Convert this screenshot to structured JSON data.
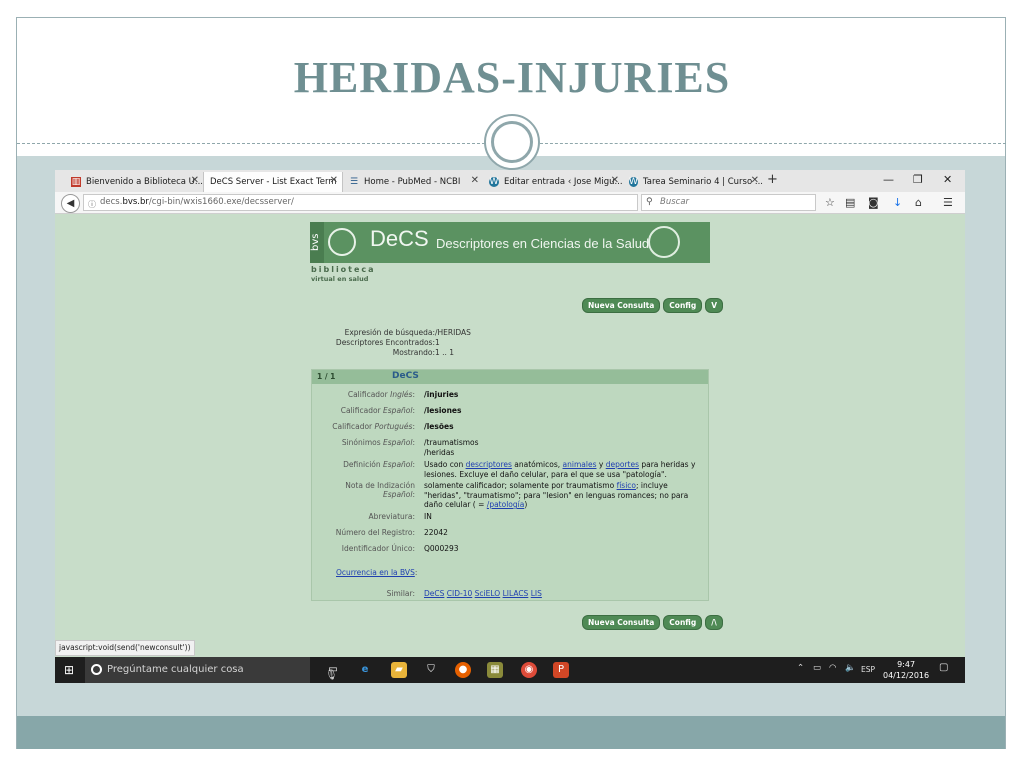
{
  "slide": {
    "title": "HERIDAS-INJURIES"
  },
  "browser": {
    "tabs": [
      {
        "label": "Bienvenido a Biblioteca U...",
        "icon": "library-favicon-icon"
      },
      {
        "label": "DeCS Server - List Exact Term",
        "icon": "none",
        "active": true
      },
      {
        "label": "Home - PubMed - NCBI",
        "icon": "pubmed-favicon-icon"
      },
      {
        "label": "Editar entrada ‹ Jose Migu...",
        "icon": "wordpress-favicon-icon"
      },
      {
        "label": "Tarea Seminario 4 | Curso ...",
        "icon": "wordpress-favicon-icon"
      }
    ],
    "url_host": "decs.bvs.br",
    "url_prefix": "decs.",
    "url_bold": "bvs.br",
    "url_path": "/cgi-bin/wxis1660.exe/decsserver/",
    "search_placeholder": "Buscar",
    "status_text": "javascript:void(send('newconsult'))"
  },
  "decs": {
    "banner_brand": "DeCS",
    "banner_subtitle": "Descriptores en Ciencias de la Salud",
    "bvs_label": "bvs",
    "biblioteca": "biblioteca",
    "virtual": "virtual en salud",
    "buttons_top": [
      "Nueva Consulta",
      "Config",
      "V"
    ],
    "buttons_bottom": [
      "Nueva Consulta",
      "Config",
      "/\\"
    ],
    "search_info": [
      {
        "label": "Expresión de búsqueda:",
        "value": "/HERIDAS"
      },
      {
        "label": "Descriptores Encontrados:",
        "value": "1"
      },
      {
        "label": "Mostrando:",
        "value": "1 .. 1"
      }
    ],
    "result": {
      "count": "1 / 1",
      "title": "DeCS",
      "calificador_ingles_label": "Calificador",
      "calificador_ingles_lang": "Inglés",
      "calificador_ingles": "/injuries",
      "calificador_espanol_label": "Calificador",
      "calificador_espanol_lang": "Español",
      "calificador_espanol": "/lesiones",
      "calificador_portugues_label": "Calificador",
      "calificador_portugues_lang": "Portugués",
      "calificador_portugues": "/lesões",
      "sinonimos_label": "Sinónimos",
      "sinonimos_lang": "Español",
      "sinonimos_1": "/traumatismos",
      "sinonimos_2": "/heridas",
      "definicion_label": "Definición",
      "definicion_lang": "Español",
      "definicion_part1": "Usado con ",
      "definicion_link1": "descriptores",
      "definicion_part2": " anatómicos, ",
      "definicion_link2": "animales",
      "definicion_part3": " y ",
      "definicion_link3": "deportes",
      "definicion_part4": " para heridas y lesiones. Excluye el daño celular, para el que se usa \"patología\".",
      "nota_label": "Nota de Indización",
      "nota_lang": "Español",
      "nota_part1": "solamente calificador; solamente por traumatismo ",
      "nota_link1": "físico",
      "nota_part2": "; incluye \"heridas\", \"traumatismo\"; para \"lesion\" en lenguas romances; no para daño celular ( = ",
      "nota_link2": "/patología",
      "nota_part3": ")",
      "abreviatura_label": "Abreviatura:",
      "abreviatura": "IN",
      "registro_label": "Número del Registro:",
      "registro": "22042",
      "identificador_label": "Identificador Único:",
      "identificador": "Q000293",
      "ocurrencia_link": "Ocurrencia en la BVS",
      "ocurrencia_suffix": ":",
      "similar_label": "Similar:",
      "similar_links": [
        "DeCS",
        "CID-10",
        "SciELO",
        "LILACS",
        "LIS"
      ]
    }
  },
  "taskbar": {
    "search_placeholder": "Pregúntame cualquier cosa",
    "language": "ESP",
    "time": "9:47",
    "date": "04/12/2016"
  }
}
